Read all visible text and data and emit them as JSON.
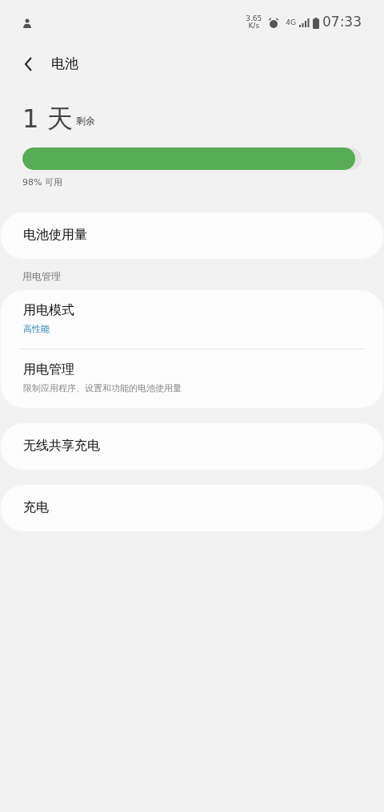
{
  "status_bar": {
    "net_speed": "3.65",
    "net_unit": "K/s",
    "network": "4G",
    "time": "07:33"
  },
  "header": {
    "title": "电池"
  },
  "battery": {
    "amount": "1 天",
    "amount_suffix": "剩余",
    "level": 0.98,
    "reading": "98% 可用"
  },
  "sections": [
    {
      "items": [
        {
          "title": "电池使用量"
        }
      ]
    },
    {
      "heading": "用电管理",
      "items": [
        {
          "title": "用电模式",
          "subtitle": "高性能",
          "kind": "value"
        },
        {
          "title": "用电管理",
          "subtitle": "限制应用程序、设置和功能的电池使用量",
          "kind": "description"
        }
      ]
    },
    {
      "items": [
        {
          "title": "无线共享充电"
        }
      ]
    },
    {
      "items": [
        {
          "title": "充电"
        }
      ]
    }
  ]
}
